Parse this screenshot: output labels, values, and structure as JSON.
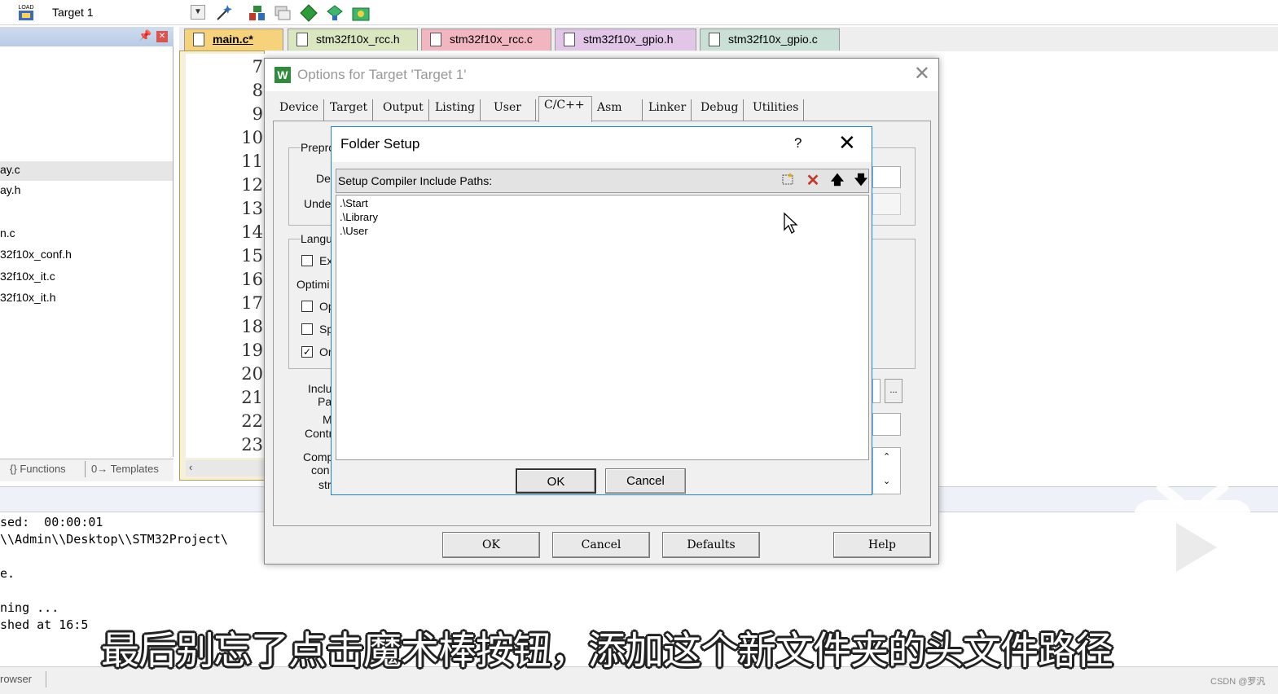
{
  "toolbar": {
    "target_label": "Target 1",
    "load_icon_label": "LOAD"
  },
  "left_panel": {
    "files": [
      "ay.c",
      "ay.h",
      "n.c",
      "32f10x_conf.h",
      "32f10x_it.c",
      "32f10x_it.h"
    ],
    "tabs": {
      "functions": "Functions",
      "templates": "Templates",
      "functions_icon": "{}",
      "templates_icon": "0→"
    }
  },
  "editor": {
    "tabs": [
      {
        "label": "main.c*",
        "color": "#f6d27a"
      },
      {
        "label": "stm32f10x_rcc.h",
        "color": "#d9e6c0"
      },
      {
        "label": "stm32f10x_rcc.c",
        "color": "#f2b6c0"
      },
      {
        "label": "stm32f10x_gpio.h",
        "color": "#e2c6e8"
      },
      {
        "label": "stm32f10x_gpio.c",
        "color": "#c8e0d6"
      }
    ],
    "line_numbers": [
      "7",
      "8",
      "9",
      "10",
      "11",
      "12",
      "13",
      "14",
      "15",
      "16",
      "17",
      "18",
      "19",
      "20",
      "21",
      "22",
      "23"
    ]
  },
  "output": {
    "lines": [
      "sed:  00:00:01",
      "\\\\Admin\\\\Desktop\\\\STM32Project\\",
      "",
      "e.",
      "",
      "ning ...",
      "shed at 16:5"
    ]
  },
  "status": {
    "browser": "rowser"
  },
  "options_dialog": {
    "title": "Options for Target 'Target 1'",
    "tabs": [
      "Device",
      "Target",
      "Output",
      "Listing",
      "User",
      "C/C++",
      "Asm",
      "Linker",
      "Debug",
      "Utilities"
    ],
    "active_tab": "C/C++",
    "labels": {
      "prepro": "Prepro",
      "de": "De",
      "unde": "Unde",
      "langu": "Langu",
      "ex": "Ex",
      "optimi": "Optimi",
      "op": "Op",
      "sp": "Sp",
      "on": "On",
      "inclu": "Inclu",
      "pa": "Pa",
      "m": "M",
      "contr": "Contr",
      "comp": "Comp",
      "con": "con",
      "str": "str",
      "ellipsis": "..."
    },
    "buttons": {
      "ok": "OK",
      "cancel": "Cancel",
      "defaults": "Defaults",
      "help": "Help"
    }
  },
  "folder_setup": {
    "title": "Folder Setup",
    "help_glyph": "?",
    "close_glyph": "✕",
    "header_label": "Setup Compiler Include Paths:",
    "paths": [
      ".\\Start",
      ".\\Library",
      ".\\User"
    ],
    "buttons": {
      "ok": "OK",
      "cancel": "Cancel"
    }
  },
  "overlay": {
    "subtitle": "最后别忘了点击魔术棒按钮，添加这个新文件夹的头文件路径",
    "watermark": "CSDN @罗汎"
  }
}
